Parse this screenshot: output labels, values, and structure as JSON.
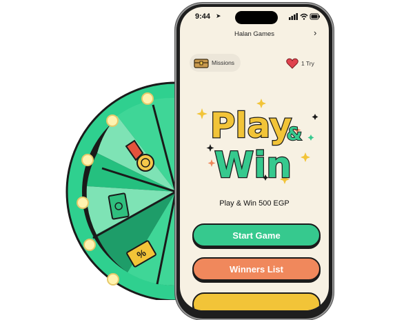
{
  "status_bar": {
    "time": "9:44"
  },
  "header": {
    "title": "Halan Games"
  },
  "missions": {
    "label": "Missions"
  },
  "tries": {
    "label": "1 Try"
  },
  "logo": {
    "line1": "Play",
    "amp": "&",
    "line2": "Win"
  },
  "subtitle": "Play & Win 500 EGP",
  "buttons": {
    "start": "Start Game",
    "winners": "Winners List"
  },
  "colors": {
    "green": "#36c98e",
    "orange": "#f0885c",
    "yellow": "#f2c438",
    "bg": "#f7f1e3"
  }
}
